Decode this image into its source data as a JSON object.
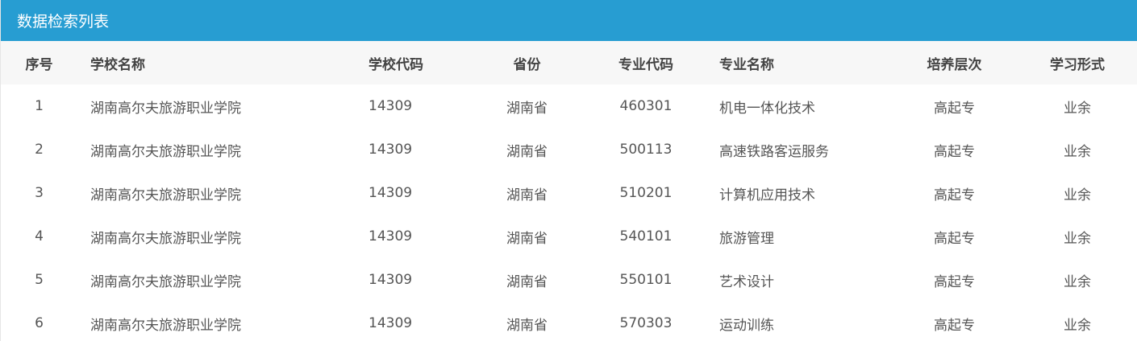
{
  "panel": {
    "title": "数据检索列表",
    "header_color": "#279dd2"
  },
  "table": {
    "columns": [
      "序号",
      "学校名称",
      "学校代码",
      "省份",
      "专业代码",
      "专业名称",
      "培养层次",
      "学习形式"
    ],
    "rows": [
      [
        "1",
        "湖南高尔夫旅游职业学院",
        "14309",
        "湖南省",
        "460301",
        "机电一体化技术",
        "高起专",
        "业余"
      ],
      [
        "2",
        "湖南高尔夫旅游职业学院",
        "14309",
        "湖南省",
        "500113",
        "高速铁路客运服务",
        "高起专",
        "业余"
      ],
      [
        "3",
        "湖南高尔夫旅游职业学院",
        "14309",
        "湖南省",
        "510201",
        "计算机应用技术",
        "高起专",
        "业余"
      ],
      [
        "4",
        "湖南高尔夫旅游职业学院",
        "14309",
        "湖南省",
        "540101",
        "旅游管理",
        "高起专",
        "业余"
      ],
      [
        "5",
        "湖南高尔夫旅游职业学院",
        "14309",
        "湖南省",
        "550101",
        "艺术设计",
        "高起专",
        "业余"
      ],
      [
        "6",
        "湖南高尔夫旅游职业学院",
        "14309",
        "湖南省",
        "570303",
        "运动训练",
        "高起专",
        "业余"
      ]
    ]
  }
}
